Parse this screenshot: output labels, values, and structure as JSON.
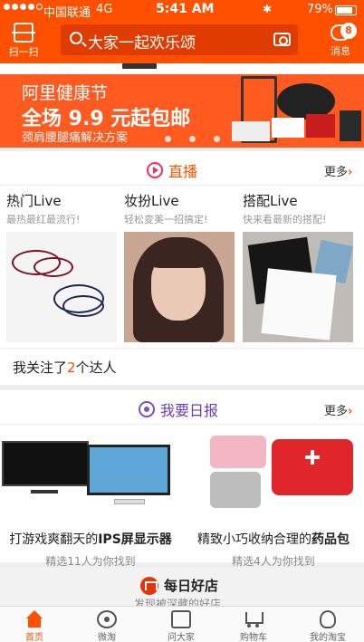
{
  "status_bar": {
    "carrier": "中国联通",
    "network": "4G",
    "time": "5:41 AM",
    "battery": "79%"
  },
  "header": {
    "scan_label": "扫一扫",
    "search_placeholder": "大家一起欢乐颂",
    "messages_label": "消息",
    "messages_badge": "8"
  },
  "banner": {
    "title": "阿里健康节",
    "headline": "全场 9.9 元起包邮",
    "subtitle": "颈肩腰腿痛解决方案",
    "page_dots": 3
  },
  "live": {
    "title": "直播",
    "more": "更多",
    "columns": [
      {
        "title": "热门Live",
        "subtitle": "最热最红最流行!"
      },
      {
        "title": "妆扮Live",
        "subtitle": "轻松变美一招搞定!"
      },
      {
        "title": "搭配Live",
        "subtitle": "快来看最新的搭配!"
      }
    ],
    "follow_prefix": "我关注了",
    "follow_count": "2",
    "follow_suffix": "个达人"
  },
  "daily": {
    "title": "我要日报",
    "more": "更多",
    "items": [
      {
        "title_prefix": "打游戏爽翻天的",
        "title_highlight": "IPS屏显示器",
        "subtitle": "精选11人为你找到"
      },
      {
        "title_prefix": "精致小巧收纳合理的",
        "title_highlight": "药品包",
        "subtitle": "精选4人为你找到"
      }
    ]
  },
  "shops": {
    "title": "每日好店",
    "subtitle": "发现被深藏的好店"
  },
  "tabbar": {
    "items": [
      {
        "label": "首页",
        "icon": "home-icon",
        "active": true
      },
      {
        "label": "微淘",
        "icon": "weitao-icon",
        "active": false
      },
      {
        "label": "问大家",
        "icon": "ask-icon",
        "active": false
      },
      {
        "label": "购物车",
        "icon": "cart-icon",
        "active": false
      },
      {
        "label": "我的淘宝",
        "icon": "profile-icon",
        "active": false
      }
    ]
  },
  "colors": {
    "brand_orange": "#ff5000",
    "live_accent": "#ff2a5a",
    "daily_accent": "#7a4fd0"
  }
}
